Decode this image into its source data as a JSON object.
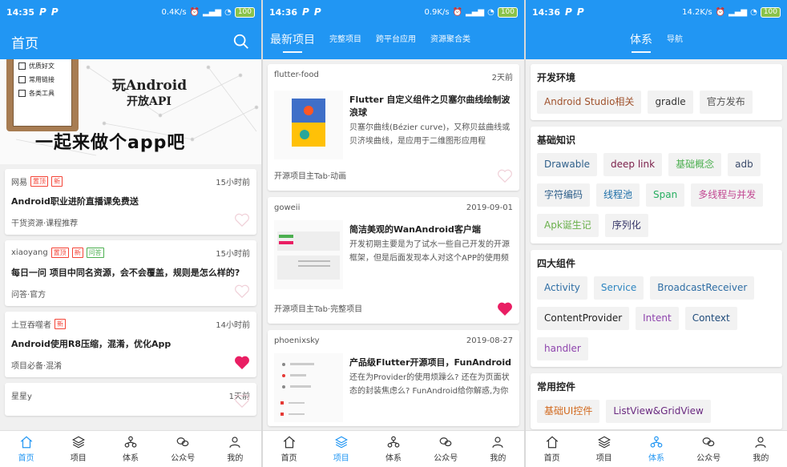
{
  "status": [
    {
      "time": "14:35",
      "badges": [
        "P",
        "P"
      ],
      "speed": "0.4K/s",
      "battery": "100"
    },
    {
      "time": "14:36",
      "badges": [
        "P",
        "P"
      ],
      "speed": "0.9K/s",
      "battery": "100"
    },
    {
      "time": "14:36",
      "badges": [
        "P",
        "P"
      ],
      "speed": "14.2K/s",
      "battery": "100"
    }
  ],
  "home": {
    "title": "首页",
    "banner": {
      "checklist": [
        "优质好文",
        "常用链接",
        "各类工具"
      ],
      "line1": "玩Android",
      "line2": "开放API",
      "slogan": "一起来做个app吧"
    },
    "articles": [
      {
        "author": "网易",
        "tags": [
          {
            "text": "置顶",
            "color": "red"
          },
          {
            "text": "新",
            "color": "red"
          }
        ],
        "time": "15小时前",
        "title": "Android职业进阶直播课免费送",
        "chapter": "干货资源·课程推荐",
        "liked": false
      },
      {
        "author": "xiaoyang",
        "tags": [
          {
            "text": "置顶",
            "color": "red"
          },
          {
            "text": "新",
            "color": "red"
          },
          {
            "text": "问答",
            "color": "green"
          }
        ],
        "time": "15小时前",
        "title": "每日一问 项目中同名资源，会不会覆盖，规则是怎么样的?",
        "chapter": "问答·官方",
        "liked": false
      },
      {
        "author": "土豆吞噬者",
        "tags": [
          {
            "text": "新",
            "color": "red"
          }
        ],
        "time": "14小时前",
        "title": "Android使用R8压缩，混淆，优化App",
        "chapter": "项目必备·混淆",
        "liked": true
      },
      {
        "author": "星星y",
        "tags": [],
        "time": "1天前",
        "title": "",
        "chapter": "",
        "liked": false
      }
    ]
  },
  "project": {
    "tabs": [
      "最新项目",
      "完整项目",
      "跨平台应用",
      "资源聚合类"
    ],
    "items": [
      {
        "author": "flutter-food",
        "time": "2天前",
        "title": "Flutter 自定义组件之贝塞尔曲线绘制波浪球",
        "desc": "贝塞尔曲线(Bézier curve)，又称贝兹曲线或贝济埃曲线，是应用于二维图形应用程",
        "chapter": "开源项目主Tab·动画",
        "liked": false
      },
      {
        "author": "goweii",
        "time": "2019-09-01",
        "title": "简洁美观的WanAndroid客户端",
        "desc": "开发初期主要是为了试水一些自己开发的开源框架，但是后面发现本人对这个APP的使用频率还是挺高的，在坐地铁的时…",
        "chapter": "开源项目主Tab·完整项目",
        "liked": true
      },
      {
        "author": "phoenixsky",
        "time": "2019-08-27",
        "title": "产品级Flutter开源项目，FunAndroid",
        "desc": "还在为Provider的使用烦躁么? 还在为页面状态的封装焦虑么? FunAndroid给你解惑,为你带来Provider的最佳实践",
        "chapter": "",
        "liked": false
      }
    ]
  },
  "system": {
    "tabs": [
      "体系",
      "导航"
    ],
    "categories": [
      {
        "name": "开发环境",
        "items": [
          "Android Studio相关",
          "gradle",
          "官方发布"
        ]
      },
      {
        "name": "基础知识",
        "items": [
          "Drawable",
          "deep link",
          "基础概念",
          "adb",
          "字符编码",
          "线程池",
          "Span",
          "多线程与并发",
          "Apk诞生记",
          "序列化"
        ]
      },
      {
        "name": "四大组件",
        "items": [
          "Activity",
          "Service",
          "BroadcastReceiver",
          "ContentProvider",
          "Intent",
          "Context",
          "handler"
        ]
      },
      {
        "name": "常用控件",
        "items": [
          "基础UI控件",
          "ListView&GridView"
        ]
      }
    ],
    "chip_colors": [
      "#a0522d",
      "#333333",
      "#555555",
      "#2e5f8a",
      "#7b1f4a",
      "#4caf50",
      "#3a4a6a",
      "#2e5f8a",
      "#1e6fa8",
      "#27ae60",
      "#c24892",
      "#6ab04c",
      "#333366",
      "#2e6da4",
      "#2e86c1",
      "#2e6da4",
      "#222222",
      "#8e44ad",
      "#1e4a7a",
      "#8e44ad",
      "#d2691e",
      "#6a2a80"
    ]
  },
  "bottom_nav": [
    "首页",
    "项目",
    "体系",
    "公众号",
    "我的"
  ],
  "colors": {
    "primary": "#2196f3",
    "liked": "#e91e63",
    "unliked": "#f0d0d8"
  }
}
